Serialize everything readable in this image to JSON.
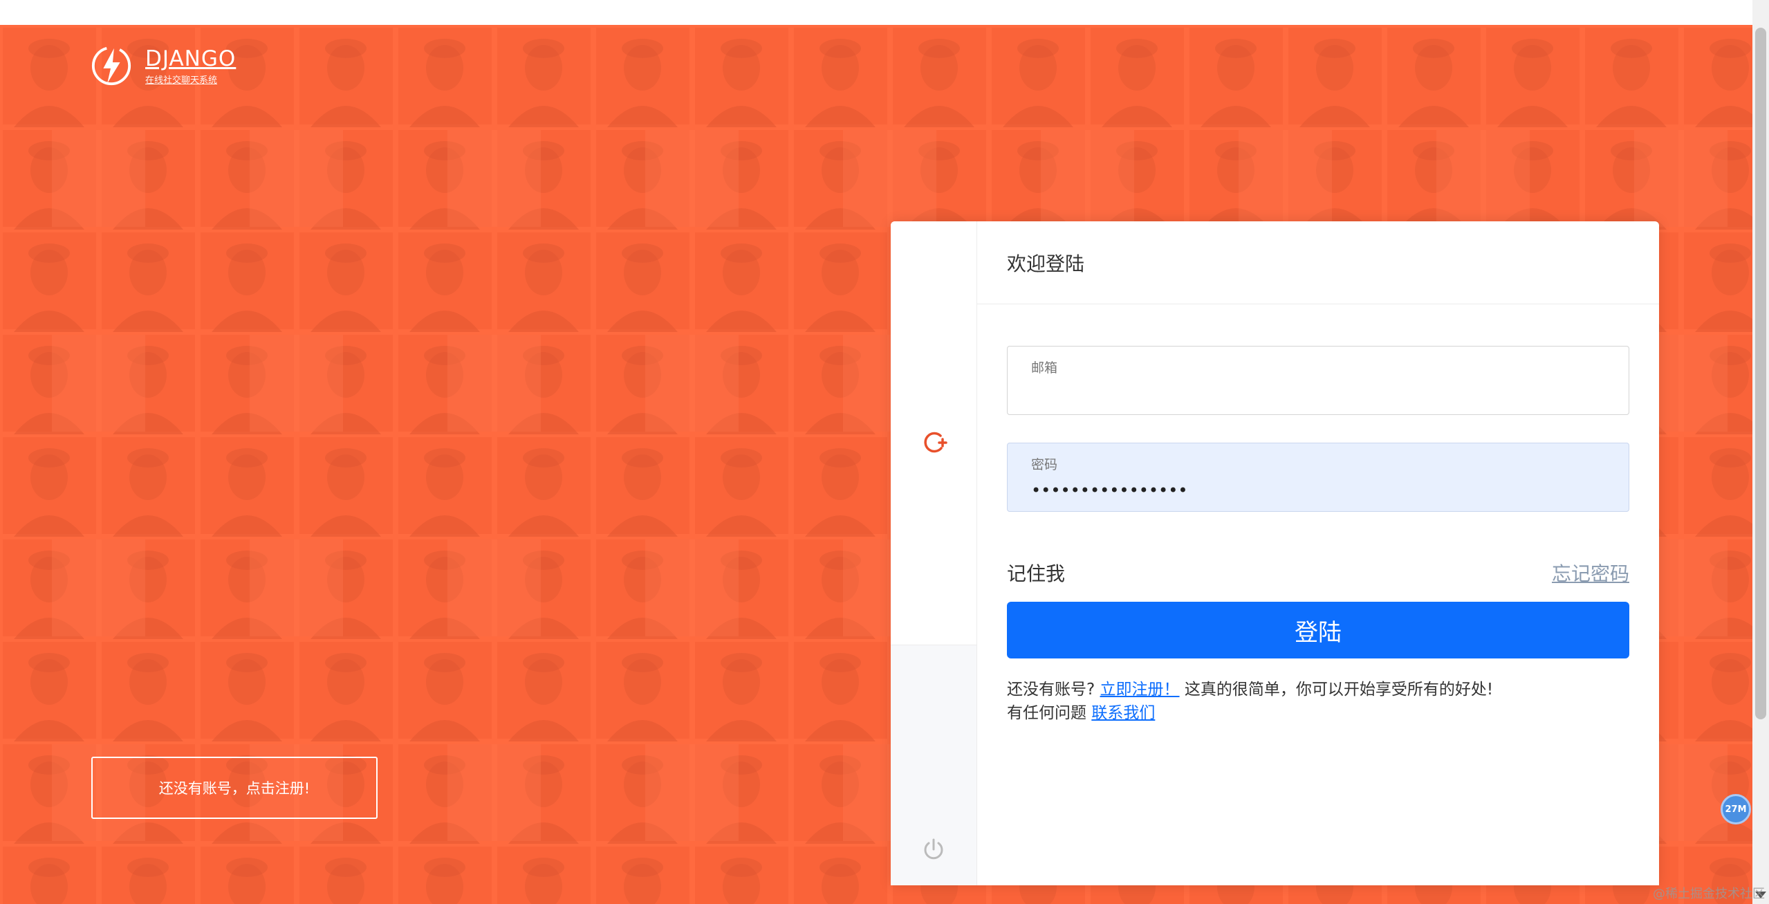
{
  "brand": {
    "name": "DJANGO",
    "tagline": "在线社交聊天系统"
  },
  "register_cta": {
    "label": "还没有账号，点击注册!"
  },
  "login_card": {
    "title": "欢迎登陆",
    "email": {
      "label": "邮箱",
      "value": ""
    },
    "password": {
      "label": "密码",
      "value": "••••••••••••••••"
    },
    "remember_label": "记住我",
    "forgot_label": "忘记密码",
    "login_label": "登陆",
    "help": {
      "no_account": "还没有账号?",
      "register_link": "立即注册！",
      "register_suffix": "这真的很简单，你可以开始享受所有的好处!",
      "question": "有任何问题",
      "contact_link": "联系我们"
    }
  },
  "overlay": {
    "memory_badge": "27M",
    "watermark": "@稀土掘金技术社区"
  },
  "colors": {
    "background": "#ff6a40",
    "primary": "#0d6efd",
    "accent_icon": "#e8502b"
  },
  "icons": {
    "logo": "lightning-bolt-icon",
    "rail_top": "sync-add-icon",
    "rail_bottom": "power-icon"
  }
}
